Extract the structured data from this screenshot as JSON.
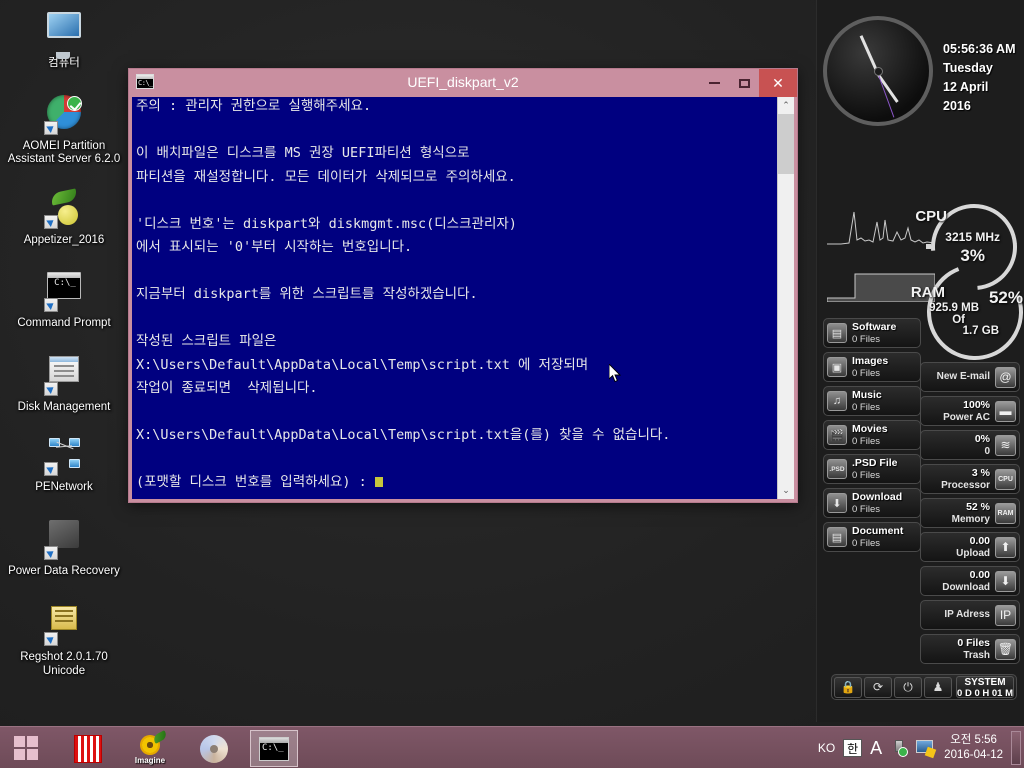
{
  "desktop": {
    "icons": [
      {
        "label": "컴퓨터",
        "icon": "computer-icon"
      },
      {
        "label": "AOMEI Partition Assistant Server 6.2.0",
        "icon": "aomei-partition-icon"
      },
      {
        "label": "Appetizer_2016",
        "icon": "appetizer-icon"
      },
      {
        "label": "Command Prompt",
        "icon": "command-prompt-icon"
      },
      {
        "label": "Disk Management",
        "icon": "disk-management-icon"
      },
      {
        "label": "PENetwork",
        "icon": "penetwork-icon"
      },
      {
        "label": "Power Data Recovery",
        "icon": "power-data-recovery-icon"
      },
      {
        "label": "Regshot 2.0.1.70 Unicode",
        "icon": "regshot-icon"
      }
    ]
  },
  "window": {
    "title": "UEFI_diskpart_v2",
    "icon": "console-icon",
    "minimize_label": "Minimize",
    "maximize_label": "Maximize",
    "close_label": "✕",
    "background_color": "#000080",
    "titlebar_color": "#c98fa0",
    "close_color": "#c85252",
    "console_lines": [
      "주의 : 관리자 권한으로 실행해주세요.",
      "",
      "이 배치파일은 디스크를 MS 권장 UEFI파티션 형식으로",
      "파티션을 재설정합니다. 모든 데이터가 삭제되므로 주의하세요.",
      "",
      "'디스크 번호'는 diskpart와 diskmgmt.msc(디스크관리자)",
      "에서 표시되는 '0'부터 시작하는 번호입니다.",
      "",
      "지금부터 diskpart를 위한 스크립트를 작성하겠습니다.",
      "",
      "작성된 스크립트 파일은",
      "X:\\Users\\Default\\AppData\\Local\\Temp\\script.txt 에 저장되며",
      "작업이 종료되면  삭제됩니다.",
      "",
      "X:\\Users\\Default\\AppData\\Local\\Temp\\script.txt을(를) 찾을 수 없습니다.",
      "",
      "(포맷할 디스크 번호를 입력하세요) :"
    ],
    "scroll_up_glyph": "⌃",
    "scroll_down_glyph": "⌄"
  },
  "clock_gadget": {
    "time": "05:56:36 AM",
    "weekday": "Tuesday",
    "date": "12 April 2016"
  },
  "perf_gadget": {
    "cpu_label": "CPU",
    "cpu_freq": "3215 MHz",
    "cpu_percent": "3%",
    "ram_label": "RAM",
    "ram_percent": "52%",
    "ram_used": "925.9 MB",
    "ram_of": "Of",
    "ram_total": "1.7 GB"
  },
  "file_categories": [
    {
      "name": "Software",
      "count": "0 Files",
      "icon": "software-icon",
      "glyph": "▤"
    },
    {
      "name": "Images",
      "count": "0 Files",
      "icon": "images-icon",
      "glyph": "▣"
    },
    {
      "name": "Music",
      "count": "0 Files",
      "icon": "music-icon",
      "glyph": "♫"
    },
    {
      "name": "Movies",
      "count": "0 Files",
      "icon": "movies-icon",
      "glyph": "🎬"
    },
    {
      "name": ".PSD File",
      "count": "0 Files",
      "icon": "psd-file-icon",
      "glyph": ".PSD"
    },
    {
      "name": "Download",
      "count": "0 Files",
      "icon": "download-icon",
      "glyph": "⬇"
    },
    {
      "name": "Document",
      "count": "0 Files",
      "icon": "document-icon",
      "glyph": "▤"
    }
  ],
  "stats": [
    {
      "l1": "",
      "l2": "New E-mail",
      "icon": "email-icon",
      "glyph": "@"
    },
    {
      "l1": "100%",
      "l2": "Power AC",
      "icon": "battery-icon",
      "glyph": "▬"
    },
    {
      "l1": "0%",
      "l2": "0",
      "icon": "wifi-icon",
      "glyph": "≋"
    },
    {
      "l1": "3 %",
      "l2": "Processor",
      "icon": "cpu-icon",
      "glyph": "CPU"
    },
    {
      "l1": "52 %",
      "l2": "Memory",
      "icon": "ram-icon",
      "glyph": "RAM"
    },
    {
      "l1": "0.00",
      "l2": "Upload",
      "icon": "upload-icon",
      "glyph": "⬆"
    },
    {
      "l1": "0.00",
      "l2": "Download",
      "icon": "download-arrow-icon",
      "glyph": "⬇"
    },
    {
      "l1": "",
      "l2": "IP Adress",
      "icon": "ip-icon",
      "glyph": "IP"
    },
    {
      "l1": "0 Files",
      "l2": "Trash",
      "icon": "trash-icon",
      "glyph": "🗑"
    }
  ],
  "bottom_bar": {
    "buttons": [
      {
        "name": "lock-button",
        "glyph": "🔒"
      },
      {
        "name": "restart-button",
        "glyph": "⟳"
      },
      {
        "name": "shutdown-button",
        "glyph": "⏻"
      },
      {
        "name": "user-button",
        "glyph": "👤"
      }
    ],
    "system_label": "SYSTEM",
    "uptime": "0 D 0 H 01 M"
  },
  "taskbar": {
    "start_label": "Start",
    "items": [
      {
        "name": "taskbar-imagine-red",
        "active": false
      },
      {
        "name": "taskbar-imagine",
        "label": "Imagine",
        "active": false
      },
      {
        "name": "taskbar-disc",
        "active": false
      },
      {
        "name": "taskbar-console",
        "active": true
      }
    ],
    "tray": {
      "language": "KO",
      "ime_korean": "한",
      "ime_alpha": "A",
      "usb_icon": "usb-safely-remove-icon",
      "display_icon": "display-settings-icon",
      "time": "오전 5:56",
      "date": "2016-04-12"
    }
  }
}
